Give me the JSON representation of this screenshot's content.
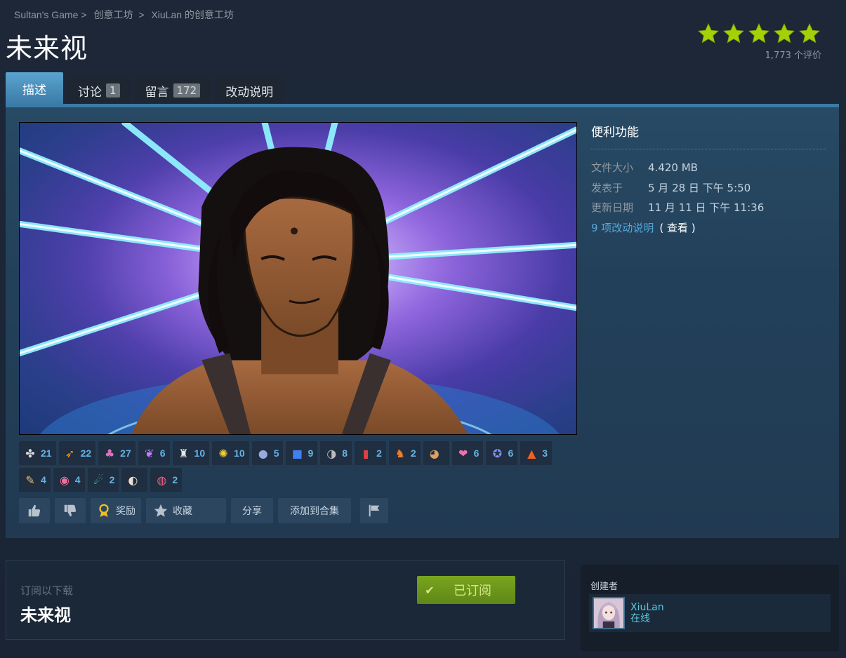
{
  "breadcrumb": [
    "Sultan's Game",
    "创意工坊",
    "XiuLan 的创意工坊"
  ],
  "title": "未来视",
  "rating": {
    "stars": 5,
    "count_label": "1,773 个评价"
  },
  "tabs": [
    {
      "label": "描述",
      "count": null
    },
    {
      "label": "讨论",
      "count": "1"
    },
    {
      "label": "留言",
      "count": "172"
    },
    {
      "label": "改动说明",
      "count": null
    }
  ],
  "side": {
    "heading": "便利功能",
    "file_size_label": "文件大小",
    "file_size": "4.420 MB",
    "posted_label": "发表于",
    "posted": "5 月 28 日 下午 5:50",
    "updated_label": "更新日期",
    "updated": "11 月 11 日 下午 11:36",
    "changes_link": "9 项改动说明",
    "view_label": "( 查看 )"
  },
  "awards_row1": [
    {
      "icon": "wings-icon",
      "glyph": "✤",
      "color": "#d8d8d8",
      "count": "21"
    },
    {
      "icon": "horn-icon",
      "glyph": "➶",
      "color": "#f0a020",
      "count": "22"
    },
    {
      "icon": "party-icon",
      "glyph": "♣",
      "color": "#e070c0",
      "count": "27"
    },
    {
      "icon": "butterfly-icon",
      "glyph": "❦",
      "color": "#c080ff",
      "count": "6"
    },
    {
      "icon": "trophy-figure-icon",
      "glyph": "♜",
      "color": "#e8e8e8",
      "count": "10"
    },
    {
      "icon": "sun-icon",
      "glyph": "✺",
      "color": "#f0d040",
      "count": "10"
    },
    {
      "icon": "cat-icon",
      "glyph": "●",
      "color": "#9ad",
      "count": "5"
    },
    {
      "icon": "present-icon",
      "glyph": "■",
      "color": "#4080f0",
      "count": "9"
    },
    {
      "icon": "moon-icon",
      "glyph": "◑",
      "color": "#bbb",
      "count": "8"
    },
    {
      "icon": "can-icon",
      "glyph": "▮",
      "color": "#e04040",
      "count": "2"
    },
    {
      "icon": "fox-icon",
      "glyph": "♞",
      "color": "#f08030",
      "count": "2"
    },
    {
      "icon": "cookie-icon",
      "glyph": "◕",
      "color": "#e0a060",
      "count": ""
    },
    {
      "icon": "heart-blob-icon",
      "glyph": "❤",
      "color": "#f070b0",
      "count": "6"
    },
    {
      "icon": "robot-cat-icon",
      "glyph": "✪",
      "color": "#8090f0",
      "count": "6"
    },
    {
      "icon": "camp-icon",
      "glyph": "▲",
      "color": "#f06020",
      "count": "3"
    }
  ],
  "awards_row2": [
    {
      "icon": "scroll-icon",
      "glyph": "✎",
      "color": "#e0c080",
      "count": "4"
    },
    {
      "icon": "fish-icon",
      "glyph": "◉",
      "color": "#f070a0",
      "count": "4"
    },
    {
      "icon": "comet-icon",
      "glyph": "☄",
      "color": "#40e0c0",
      "count": "2"
    },
    {
      "icon": "pearl-icon",
      "glyph": "◐",
      "color": "#f0e0d0",
      "count": ""
    },
    {
      "icon": "snail-icon",
      "glyph": "◍",
      "color": "#f06080",
      "count": "2"
    }
  ],
  "actions": {
    "award": "奖励",
    "favorite": "收藏",
    "share": "分享",
    "add_to_collection": "添加到合集"
  },
  "subscribe": {
    "label": "订阅以下载",
    "name": "未来视",
    "button": "已订阅"
  },
  "creator": {
    "heading": "创建者",
    "name": "XiuLan",
    "status": "在线"
  },
  "colors": {
    "accent": "#3b7ba8",
    "link": "#57a6d6",
    "subscribed": "#79a51e",
    "star": "#a4d007"
  }
}
